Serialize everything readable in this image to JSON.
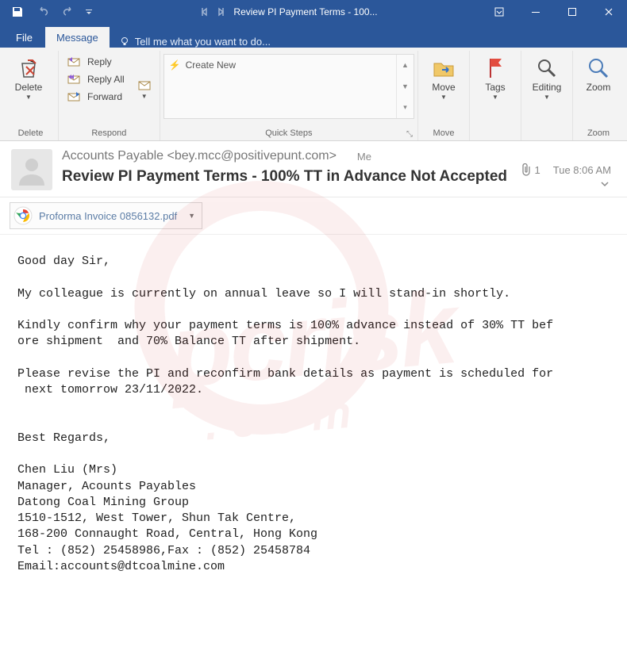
{
  "title": "Review PI Payment Terms - 100...",
  "tabs": {
    "file": "File",
    "message": "Message",
    "tellme": "Tell me what you want to do..."
  },
  "ribbon": {
    "delete": {
      "label": "Delete",
      "group": "Delete"
    },
    "respond": {
      "reply": "Reply",
      "replyall": "Reply All",
      "forward": "Forward",
      "group": "Respond"
    },
    "quicksteps": {
      "create": "Create New",
      "group": "Quick Steps"
    },
    "move": {
      "label": "Move",
      "group": "Move"
    },
    "tags": {
      "label": "Tags"
    },
    "editing": {
      "label": "Editing"
    },
    "zoom": {
      "label": "Zoom",
      "group": "Zoom"
    }
  },
  "header": {
    "from_name": "Accounts Payable",
    "from_addr": "<bey.mcc@positivepunt.com>",
    "to": "Me",
    "att_count": "1",
    "date": "Tue 8:06 AM",
    "subject": "Review PI Payment Terms - 100% TT in Advance Not Accepted"
  },
  "attachment": {
    "name": "Proforma Invoice 0856132.pdf"
  },
  "body": "Good day Sir,\n\nMy colleague is currently on annual leave so I will stand-in shortly.\n\nKindly confirm why your payment terms is 100% advance instead of 30% TT bef\nore shipment  and 70% Balance TT after shipment.\n\nPlease revise the PI and reconfirm bank details as payment is scheduled for\n next tomorrow 23/11/2022.\n\n\nBest Regards,\n\nChen Liu (Mrs)\nManager, Acounts Payables\nDatong Coal Mining Group\n1510-1512, West Tower, Shun Tak Centre,\n168-200 Connaught Road, Central, Hong Kong\nTel : (852) 25458986,Fax : (852) 25458784\nEmail:accounts@dtcoalmine.com",
  "watermark": {
    "main": "pcrisk",
    "sub": ".com"
  }
}
